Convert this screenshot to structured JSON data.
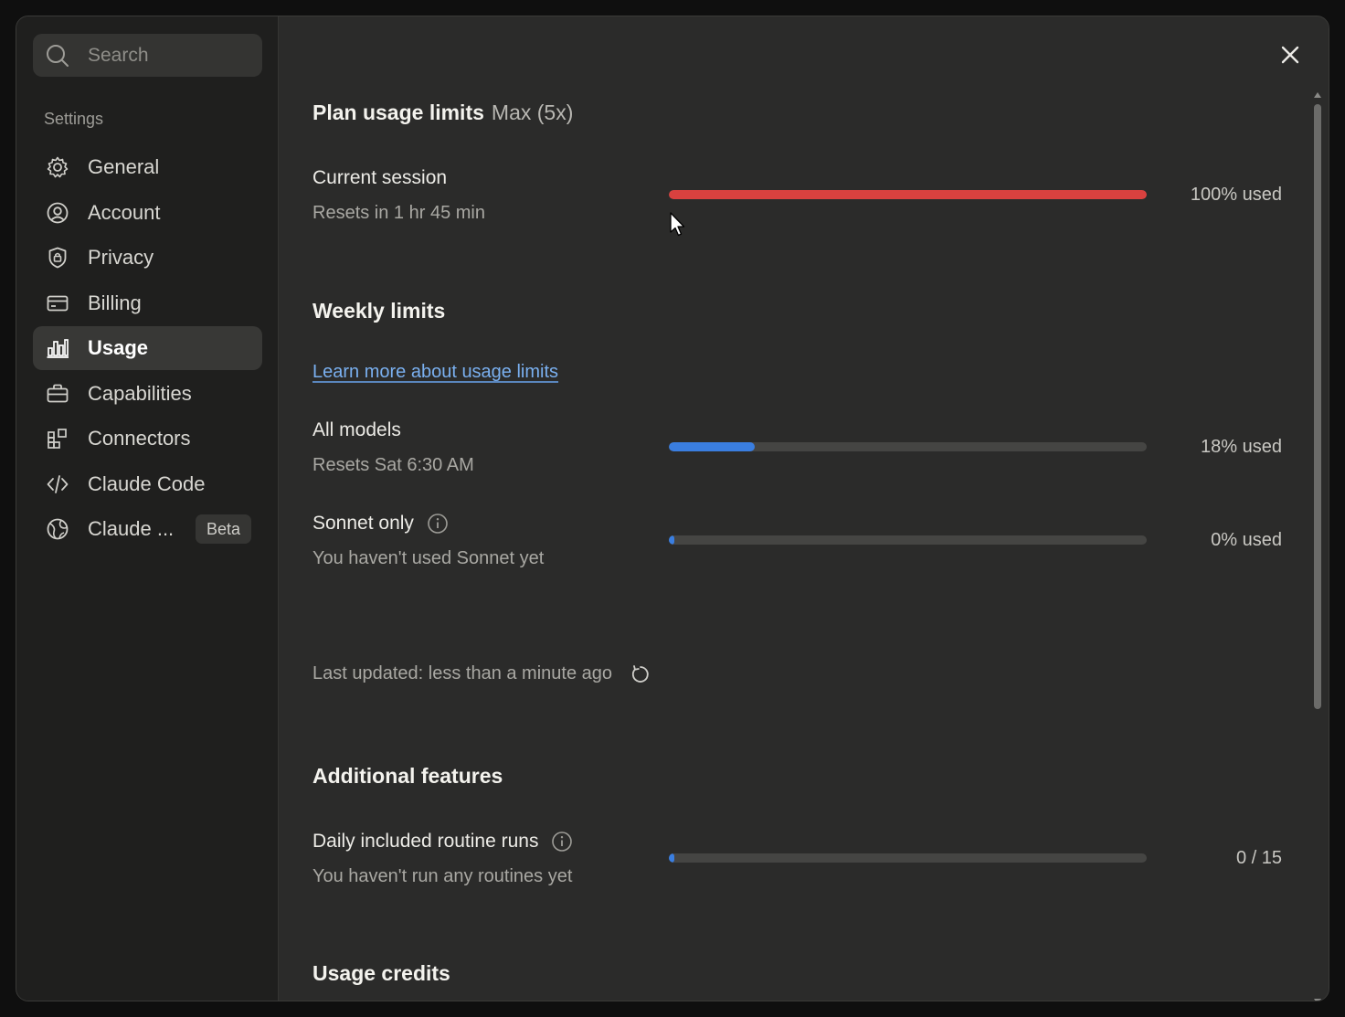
{
  "search": {
    "placeholder": "Search"
  },
  "sidebar": {
    "section_label": "Settings",
    "items": [
      {
        "label": "General",
        "icon": "gear-icon"
      },
      {
        "label": "Account",
        "icon": "user-circle-icon"
      },
      {
        "label": "Privacy",
        "icon": "shield-lock-icon"
      },
      {
        "label": "Billing",
        "icon": "credit-card-icon"
      },
      {
        "label": "Usage",
        "icon": "bar-chart-icon",
        "active": true
      },
      {
        "label": "Capabilities",
        "icon": "briefcase-icon"
      },
      {
        "label": "Connectors",
        "icon": "puzzle-icon"
      },
      {
        "label": "Claude Code",
        "icon": "code-icon"
      },
      {
        "label": "Claude ...",
        "icon": "globe-icon",
        "badge": "Beta"
      }
    ]
  },
  "main": {
    "title": "Plan usage limits",
    "plan": "Max (5x)",
    "current_session": {
      "title": "Current session",
      "subtitle": "Resets in 1 hr 45 min",
      "percent": 100,
      "used_label": "100% used",
      "color": "#d9413f"
    },
    "weekly": {
      "heading": "Weekly limits",
      "learn_more": "Learn more about usage limits",
      "all_models": {
        "title": "All models",
        "subtitle": "Resets Sat 6:30 AM",
        "percent": 18,
        "used_label": "18% used",
        "color": "#3a7ee0"
      },
      "sonnet": {
        "title": "Sonnet only",
        "subtitle": "You haven't used Sonnet yet",
        "percent": 0,
        "used_label": "0% used",
        "color": "#3a7ee0"
      }
    },
    "last_updated": "Last updated: less than a minute ago",
    "additional": {
      "heading": "Additional features",
      "routines": {
        "title": "Daily included routine runs",
        "subtitle": "You haven't run any routines yet",
        "used": 0,
        "total": 15,
        "used_label": "0 / 15",
        "color": "#3a7ee0"
      }
    },
    "credits_heading": "Usage credits"
  }
}
